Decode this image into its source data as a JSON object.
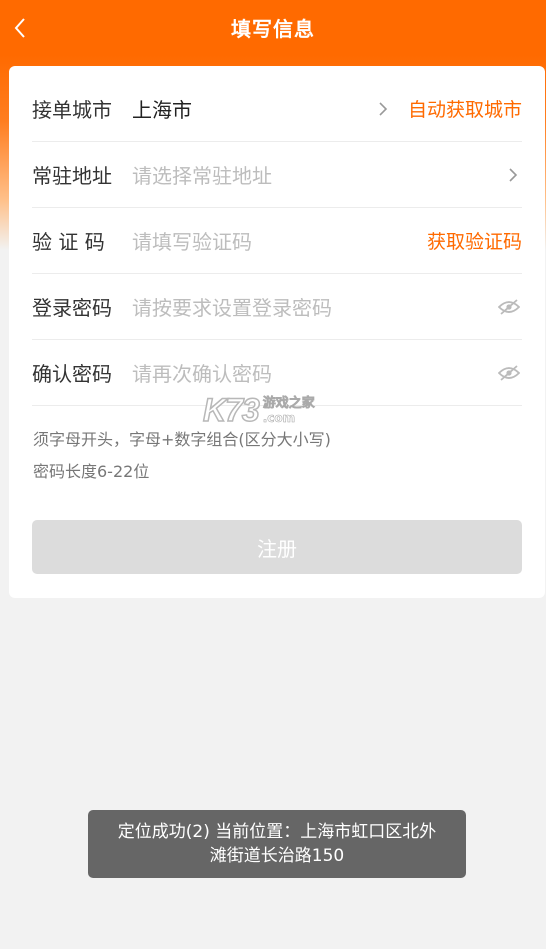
{
  "header": {
    "title": "填写信息"
  },
  "form": {
    "city": {
      "label": "接单城市",
      "value": "上海市",
      "action": "自动获取城市"
    },
    "address": {
      "label": "常驻地址",
      "placeholder": "请选择常驻地址"
    },
    "code": {
      "label": "验 证 码",
      "placeholder": "请填写验证码",
      "action": "获取验证码"
    },
    "password": {
      "label": "登录密码",
      "placeholder": "请按要求设置登录密码"
    },
    "confirm": {
      "label": "确认密码",
      "placeholder": "请再次确认密码"
    },
    "hint_line1": "须字母开头，字母+数字组合(区分大小写)",
    "hint_line2": "密码长度6-22位",
    "submit_label": "注册"
  },
  "watermark": {
    "logo": "K73",
    "text_cn": "游戏之家",
    "text_com": ".com"
  },
  "toast": {
    "line1": "定位成功(2) 当前位置：上海市虹口区北外",
    "line2": "滩街道长治路150"
  },
  "colors": {
    "accent": "#ff6a00",
    "background": "#f2f2f2",
    "button_disabled": "#dcdcdc",
    "toast": "#666666"
  },
  "icons": {
    "back": "chevron-left-icon",
    "chevron": "chevron-right-icon",
    "eye": "eye-off-icon"
  }
}
